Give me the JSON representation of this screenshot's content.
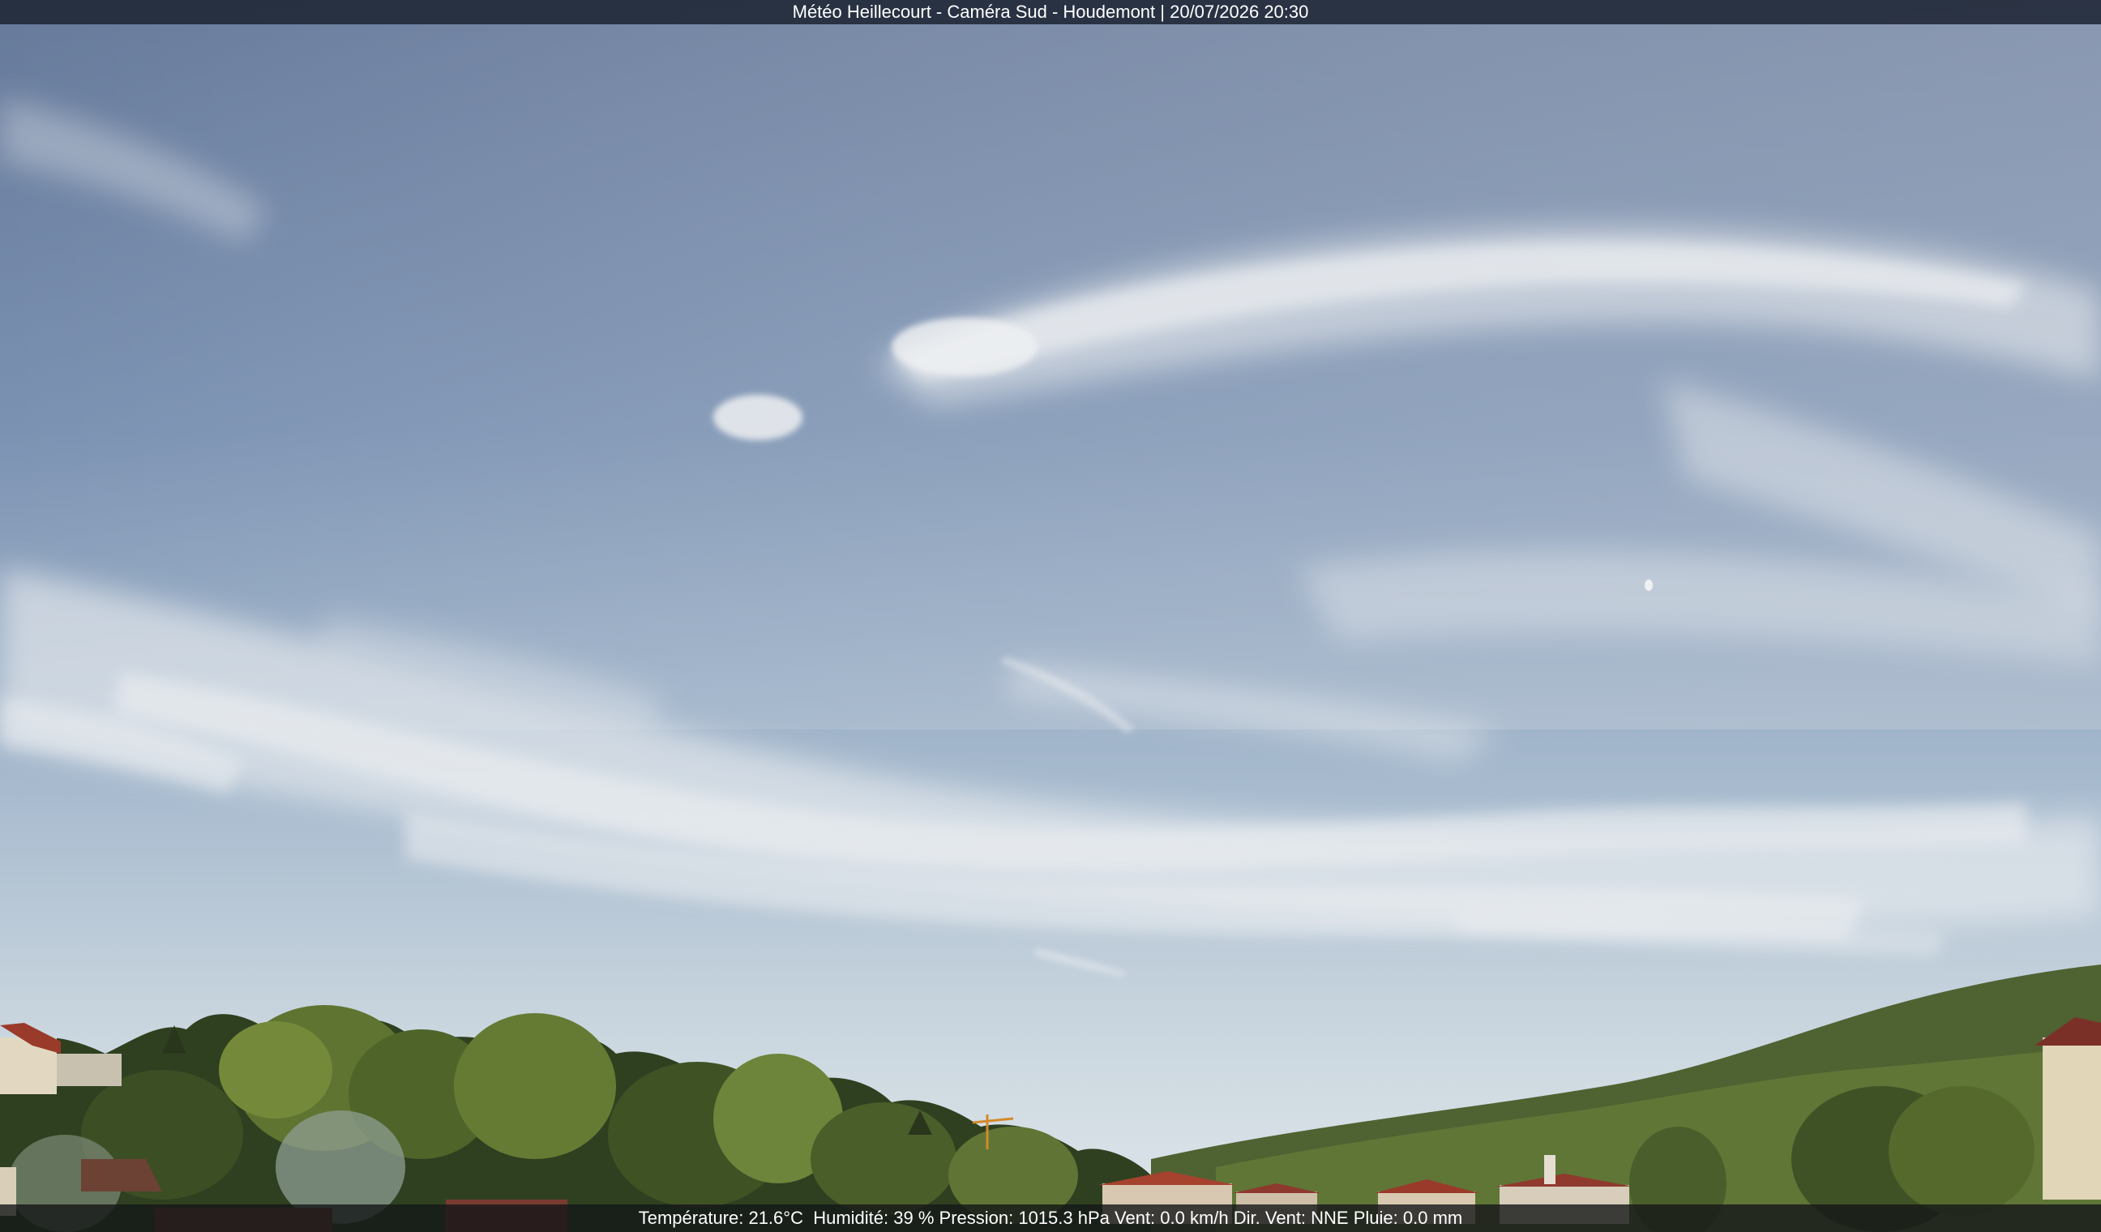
{
  "overlay": {
    "title": "Météo Heillecourt - Caméra Sud - Houdemont | 20/07/2026 20:30",
    "status": {
      "temperature": "Température: 21.6°C",
      "humidity": "Humidité: 39 %",
      "pressure": "Pression: 1015.3 hPa",
      "wind": "Vent: 0.0 km/h",
      "wind_dir": "Dir. Vent: NNE",
      "rain": "Pluie: 0.0 mm"
    }
  },
  "colors": {
    "sky_top": "#687b9b",
    "sky_mid": "#8ea6c2",
    "sky_horizon": "#d8e2e8",
    "cloud": "#e9ecef",
    "trees_dark": "#2f3d1f",
    "trees_light": "#7a8f3c",
    "roof": "#9a3a2a"
  }
}
